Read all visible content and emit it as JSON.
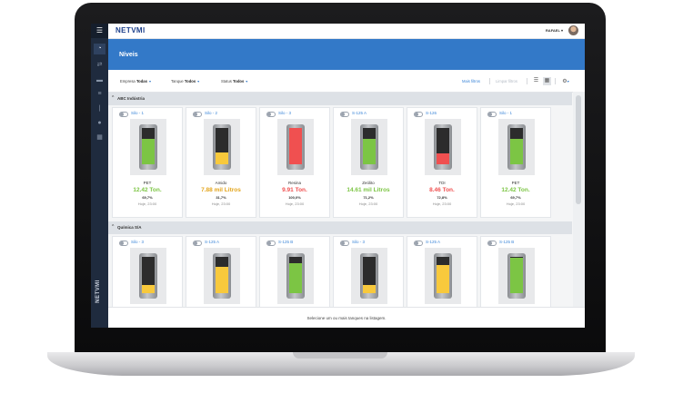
{
  "app": {
    "brand": "NETVMI",
    "brand_vertical": "NETVMI"
  },
  "user": {
    "name": "RAFAEL"
  },
  "page": {
    "title": "Níveis"
  },
  "filters": {
    "empresa_label": "Empresa",
    "empresa_value": "Todas",
    "tanque_label": "Tanque",
    "tanque_value": "Todos",
    "status_label": "Status",
    "status_value": "Todos",
    "more_filters": "Mais filtros",
    "clear_filters": "Limpar filtros"
  },
  "colors": {
    "green": "#7cc544",
    "yellow": "#f8c93c",
    "red": "#f05050",
    "accent": "#3379c8"
  },
  "groups": [
    {
      "name": "ABC Indústria",
      "tanks": [
        {
          "name": "Silo - 1",
          "product": "PET",
          "quantity": "12.42 Ton.",
          "percent": "69,7%",
          "time": "Hoje, 23:00",
          "level": 0.697,
          "color": "green"
        },
        {
          "name": "Silo - 2",
          "product": "Amido",
          "quantity": "7.88 mil Litros",
          "percent": "31,7%",
          "time": "Hoje, 23:00",
          "level": 0.317,
          "color": "yellow"
        },
        {
          "name": "Silo - 3",
          "product": "Resina",
          "quantity": "9.91 Ton.",
          "percent": "100,0%",
          "time": "Hoje, 23:00",
          "level": 1.0,
          "color": "red"
        },
        {
          "name": "S-125 A",
          "product": "Zeólito",
          "quantity": "14.61 mil Litros",
          "percent": "71,2%",
          "time": "Hoje, 23:00",
          "level": 0.712,
          "color": "green"
        },
        {
          "name": "S-126",
          "product": "TDI",
          "quantity": "8.46 Ton.",
          "percent": "72,8%",
          "time": "Hoje, 23:00",
          "level": 0.3,
          "color": "red"
        },
        {
          "name": "Silo - 1",
          "product": "PET",
          "quantity": "12.42 Ton.",
          "percent": "69,7%",
          "time": "Hoje, 23:00",
          "level": 0.697,
          "color": "green"
        }
      ]
    },
    {
      "name": "Química S/A",
      "tanks": [
        {
          "name": "Silo - 3",
          "level": 0.22,
          "color": "yellow"
        },
        {
          "name": "S-125 A",
          "level": 0.72,
          "color": "yellow"
        },
        {
          "name": "S-125 B",
          "level": 0.82,
          "color": "green"
        },
        {
          "name": "Silo - 3",
          "level": 0.22,
          "color": "yellow"
        },
        {
          "name": "S-125 A",
          "level": 0.78,
          "color": "yellow"
        },
        {
          "name": "S-125 B",
          "level": 0.97,
          "color": "green"
        }
      ]
    }
  ],
  "status": {
    "message": "Selecione um ou mais tanques na listagem."
  }
}
